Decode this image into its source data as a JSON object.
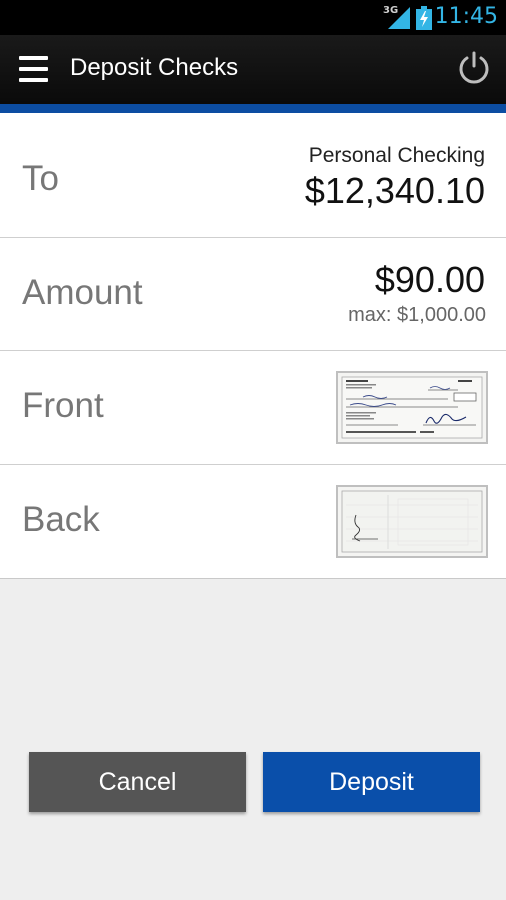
{
  "status_bar": {
    "network": "3G",
    "time": "11:45",
    "accent_color": "#33b5e5"
  },
  "action_bar": {
    "title": "Deposit Checks",
    "menu_icon": "hamburger-menu-icon",
    "power_icon": "power-icon",
    "accent_color": "#0c4da2"
  },
  "form": {
    "to": {
      "label": "To",
      "account_name": "Personal Checking",
      "account_balance": "$12,340.10"
    },
    "amount": {
      "label": "Amount",
      "value": "$90.00",
      "max": "max: $1,000.00"
    },
    "front": {
      "label": "Front"
    },
    "back": {
      "label": "Back"
    }
  },
  "buttons": {
    "cancel": "Cancel",
    "deposit": "Deposit",
    "cancel_color": "#555555",
    "deposit_color": "#0a4faa"
  }
}
